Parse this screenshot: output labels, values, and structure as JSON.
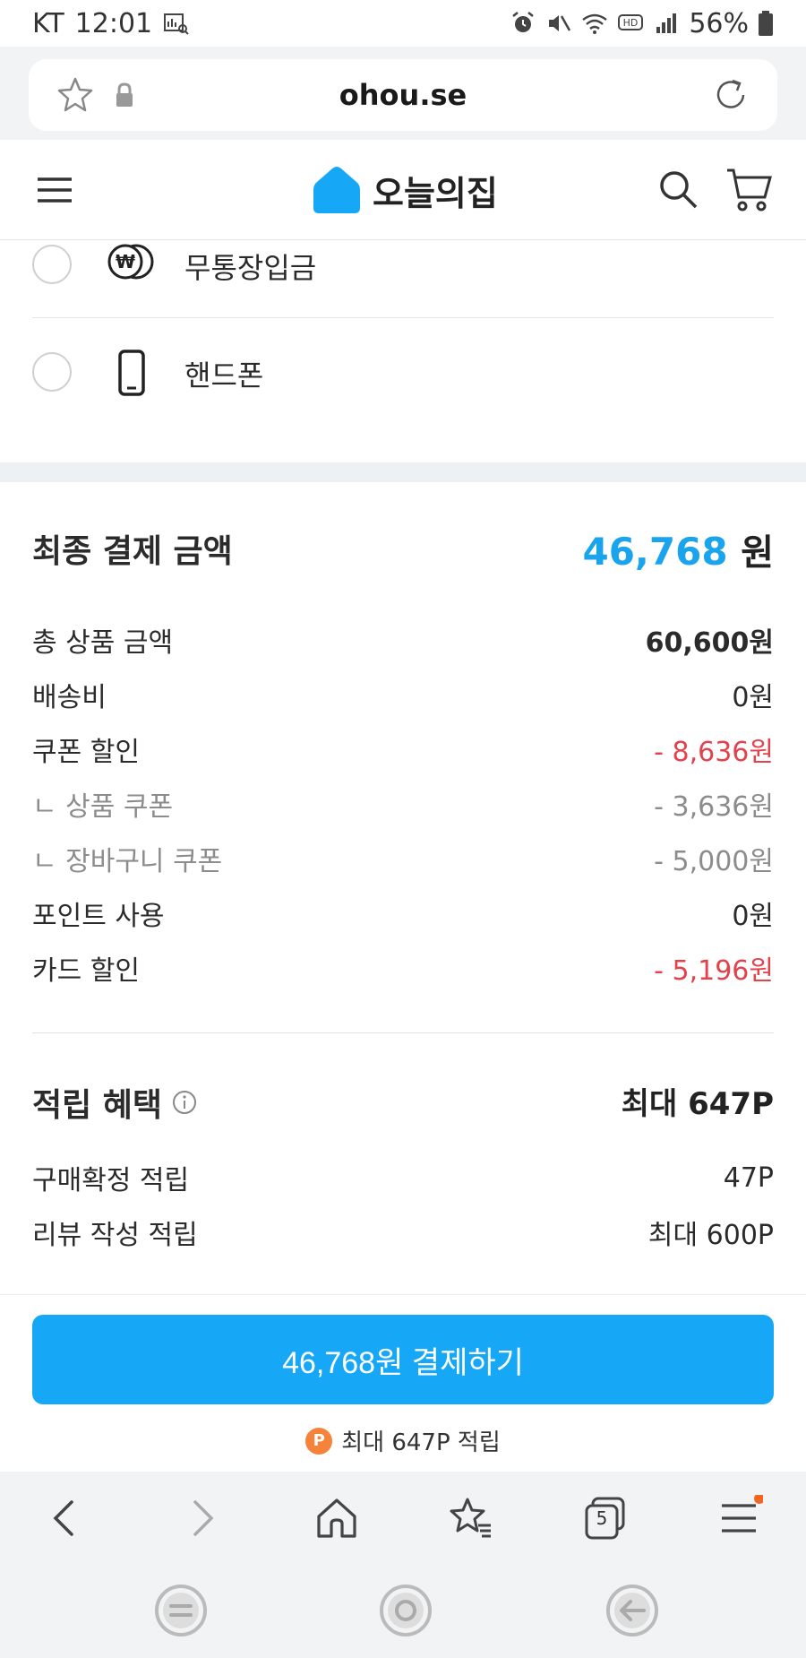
{
  "status_bar": {
    "carrier": "KT",
    "time": "12:01",
    "battery": "56%"
  },
  "browser": {
    "url": "ohou.se",
    "tab_count": "5"
  },
  "header": {
    "logo_text": "오늘의집"
  },
  "payment_methods": [
    {
      "label": "무통장입금",
      "icon": "won-coins-icon"
    },
    {
      "label": "핸드폰",
      "icon": "mobile-phone-icon"
    }
  ],
  "summary": {
    "title": "최종 결제 금액",
    "total_amount": "46,768",
    "total_unit": "원",
    "lines": [
      {
        "label": "총 상품 금액",
        "value": "60,600원"
      },
      {
        "label": "배송비",
        "value": "0원"
      },
      {
        "label": "쿠폰 할인",
        "value": "- 8,636원"
      },
      {
        "label": "ㄴ 상품 쿠폰",
        "value": "- 3,636원"
      },
      {
        "label": "ㄴ 장바구니 쿠폰",
        "value": "- 5,000원"
      },
      {
        "label": "포인트 사용",
        "value": "0원"
      },
      {
        "label": "카드 할인",
        "value": "- 5,196원"
      }
    ]
  },
  "rewards": {
    "title": "적립 혜택",
    "total": "최대 647P",
    "lines": [
      {
        "label": "구매확정 적립",
        "value": "47P"
      },
      {
        "label": "리뷰 작성 적립",
        "value": "최대 600P"
      }
    ]
  },
  "cta": {
    "button_label": "46,768원 결제하기",
    "points_badge": "P",
    "points_note": "최대 647P 적립"
  },
  "colors": {
    "accent": "#16a8f6",
    "total_blue": "#1aa4ee",
    "discount_red": "#e3424d",
    "points_orange": "#f5843a"
  }
}
